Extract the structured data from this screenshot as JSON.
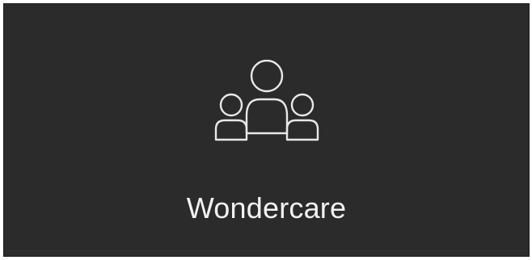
{
  "card": {
    "title": "Wondercare",
    "icon": "group-people-icon",
    "background_color": "#2b2b2b",
    "text_color": "#f2f2f2"
  }
}
